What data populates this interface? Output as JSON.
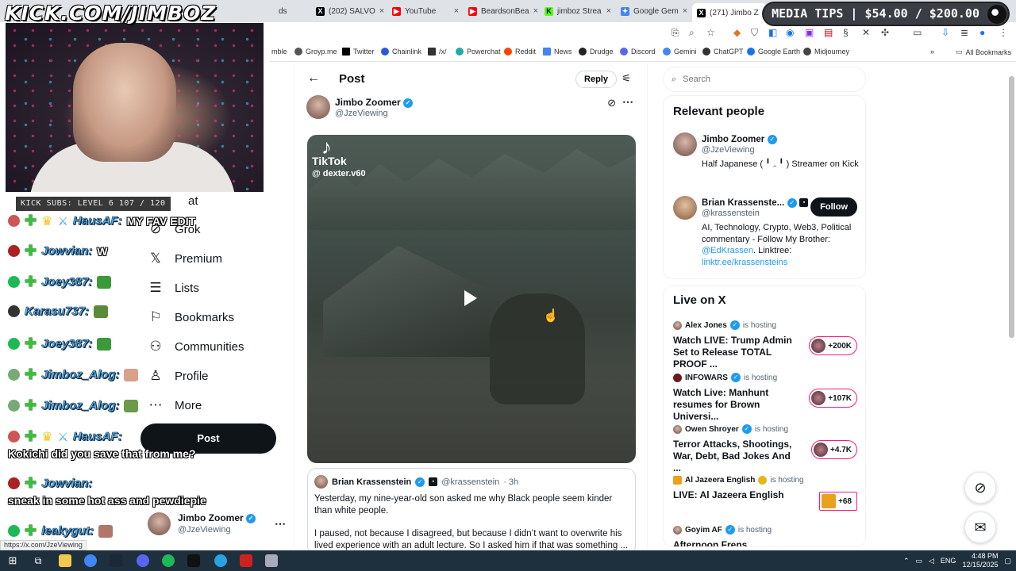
{
  "overlay": {
    "brand": "KICK.COM/JIMBOZ",
    "subs_bar": "KICK SUBS: LEVEL 6 107 / 120",
    "media_tips": "MEDIA TIPS | $54.00 / $200.00"
  },
  "chat": [
    {
      "user": "HausAF:",
      "text": "MY FAV EDIT",
      "user_color": "#5fb8f5"
    },
    {
      "user": "Jowvian:",
      "text": "W",
      "user_color": "#5fb8f5"
    },
    {
      "user": "Joey387:",
      "text": "",
      "user_color": "#5fb8f5"
    },
    {
      "user": "Karasu737:",
      "text": "",
      "user_color": "#5fb8f5"
    },
    {
      "user": "Joey387:",
      "text": "",
      "user_color": "#5fb8f5"
    },
    {
      "user": "Jimboz_Alog:",
      "text": "",
      "user_color": "#5fb8f5"
    },
    {
      "user": "Jimboz_Alog:",
      "text": "",
      "user_color": "#5fb8f5"
    },
    {
      "user": "HausAF:",
      "text": "Kokichi did you save that from me?",
      "user_color": "#5fb8f5"
    },
    {
      "user": "Jowvian:",
      "text": "sneak in some hot ass and pewdiepie",
      "user_color": "#5fb8f5"
    },
    {
      "user": "leakygut:",
      "text": "",
      "user_color": "#5fb8f5"
    }
  ],
  "tabs": [
    {
      "label": "ds",
      "fav": "",
      "active": false
    },
    {
      "label": "(202) SALVO",
      "fav": "X",
      "active": false
    },
    {
      "label": "YouTube",
      "fav": "▶",
      "active": false
    },
    {
      "label": "BeardsonBea",
      "fav": "▶",
      "active": false
    },
    {
      "label": "jimboz Strea",
      "fav": "K",
      "active": false
    },
    {
      "label": "Google Gem",
      "fav": "✦",
      "active": false
    },
    {
      "label": "(271) Jimbo Z",
      "fav": "X",
      "active": true
    }
  ],
  "bookmarks": [
    "mble",
    "Groyp.me",
    "Twitter",
    "Chainlink",
    "/x/",
    "Powerchat",
    "Reddit",
    "News",
    "Drudge",
    "Discord",
    "Gemini",
    "ChatGPT",
    "Google Earth",
    "Midjourney"
  ],
  "all_bookmarks": "All Bookmarks",
  "nav": {
    "partial_top": "at",
    "items": [
      {
        "label": "Grok",
        "icon": "grok-icon",
        "glyph": "⊘"
      },
      {
        "label": "Premium",
        "icon": "x-premium-icon",
        "glyph": "𝕏"
      },
      {
        "label": "Lists",
        "icon": "lists-icon",
        "glyph": "☰"
      },
      {
        "label": "Bookmarks",
        "icon": "bookmark-icon",
        "glyph": "⚐"
      },
      {
        "label": "Communities",
        "icon": "communities-icon",
        "glyph": "⚇"
      },
      {
        "label": "Profile",
        "icon": "profile-icon",
        "glyph": "♙"
      },
      {
        "label": "More",
        "icon": "more-circle-icon",
        "glyph": "⋯"
      }
    ],
    "post_button": "Post",
    "account_name": "Jimbo Zoomer",
    "account_handle": "@JzeViewing"
  },
  "post": {
    "header_title": "Post",
    "reply_label": "Reply",
    "author_name": "Jimbo Zoomer",
    "author_handle": "@JzeViewing",
    "tiktok_brand": "TikTok",
    "tiktok_handle": "@ dexter.v60",
    "quote": {
      "name": "Brian Krassenstein",
      "handle": "@krassenstein",
      "time": "· 3h",
      "line1": "Yesterday, my nine-year-old son asked me why Black people seem kinder than white people.",
      "line2": "I paused, not because I disagreed, but because I didn’t want to overwrite his lived experience with an adult lecture. So I asked him if that was something ..."
    }
  },
  "search": {
    "placeholder": "Search"
  },
  "relevant": {
    "title": "Relevant people",
    "people": [
      {
        "name": "Jimbo Zoomer",
        "handle": "@JzeViewing",
        "bio": "Half Japanese ( ╹ ﮧ ╹ ) Streamer on Kick"
      },
      {
        "name": "Brian Krassenste...",
        "handle": "@krassenstein",
        "bio_a": "AI, Technology, Crypto, Web3, Political commentary - Follow My Brother: ",
        "bio_link1": "@EdKrassen",
        "bio_b": ". Linktree: ",
        "bio_link2": "linktr.ee/krassensteins"
      }
    ],
    "follow_label": "Follow"
  },
  "live": {
    "title": "Live on X",
    "hosting_label": "is hosting",
    "items": [
      {
        "host": "Alex Jones",
        "title": "Watch LIVE: Trump Admin Set to Release TOTAL PROOF ...",
        "count": "+200K"
      },
      {
        "host": "INFOWARS",
        "title": "Watch Live: Manhunt resumes for Brown Universi...",
        "count": "+107K"
      },
      {
        "host": "Owen Shroyer",
        "title": "Terror Attacks, Shootings, War, Debt, Bad Jokes And ...",
        "count": "+4.7K"
      },
      {
        "host": "Al Jazeera English",
        "title": "LIVE: Al Jazeera English",
        "count": "+68"
      },
      {
        "host": "Goyim AF",
        "title": "Afternoon Frens",
        "count": ""
      }
    ]
  },
  "status_url": "https://x.com/JzeViewing",
  "taskbar": {
    "lang": "ENG",
    "time": "4:48 PM",
    "date": "12/15/2025"
  }
}
